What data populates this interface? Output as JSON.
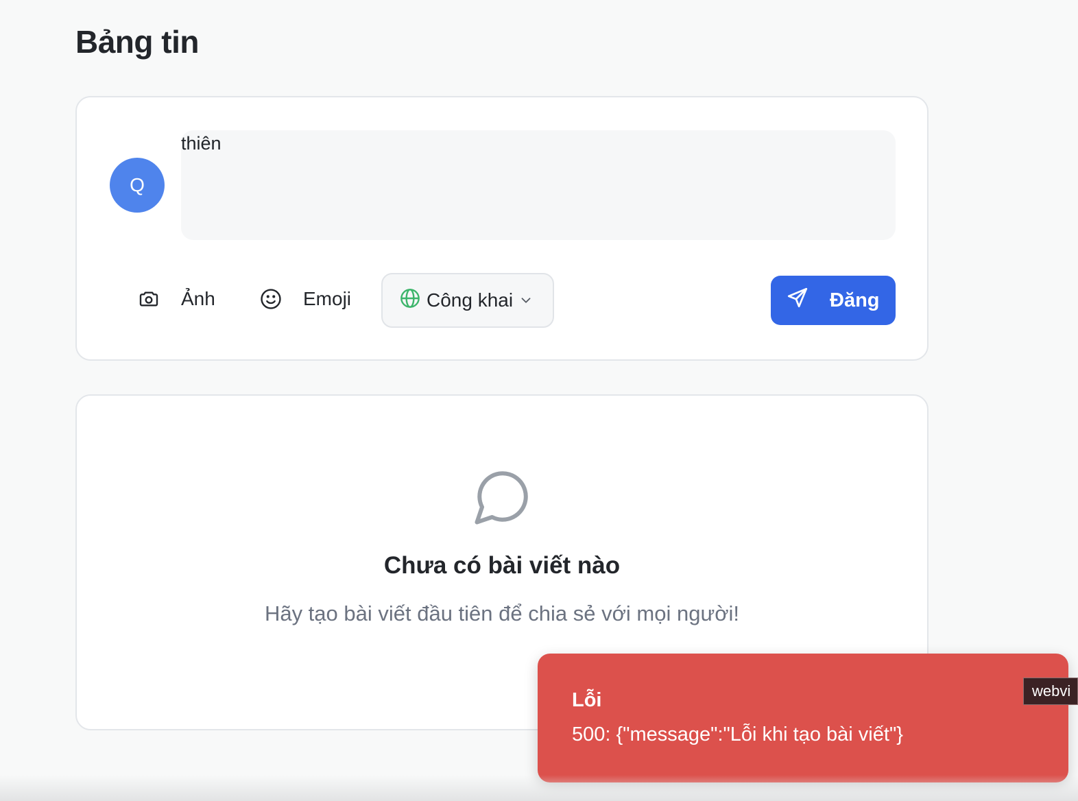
{
  "page": {
    "title": "Bảng tin"
  },
  "composer": {
    "avatar_initial": "Q",
    "input_value": "thiên",
    "photo_label": "Ảnh",
    "photo_icon": "camera-icon",
    "emoji_label": "Emoji",
    "emoji_icon": "smile-icon",
    "privacy": {
      "selected": "Công khai",
      "icon": "globe-icon"
    },
    "submit_label": "Đăng",
    "submit_icon": "send-icon"
  },
  "feed": {
    "empty_icon": "chat-bubble-icon",
    "empty_title": "Chưa có bài viết nào",
    "empty_desc": "Hãy tạo bài viết đầu tiên để chia sẻ với mọi người!"
  },
  "toast": {
    "title": "Lỗi",
    "message": "500: {\"message\":\"Lỗi khi tạo bài viết\"}"
  },
  "tooltip": {
    "text": "webvi"
  },
  "colors": {
    "accent": "#3366e6",
    "avatar": "#4f84ec",
    "error": "#dc514c",
    "globe": "#3db56b"
  }
}
